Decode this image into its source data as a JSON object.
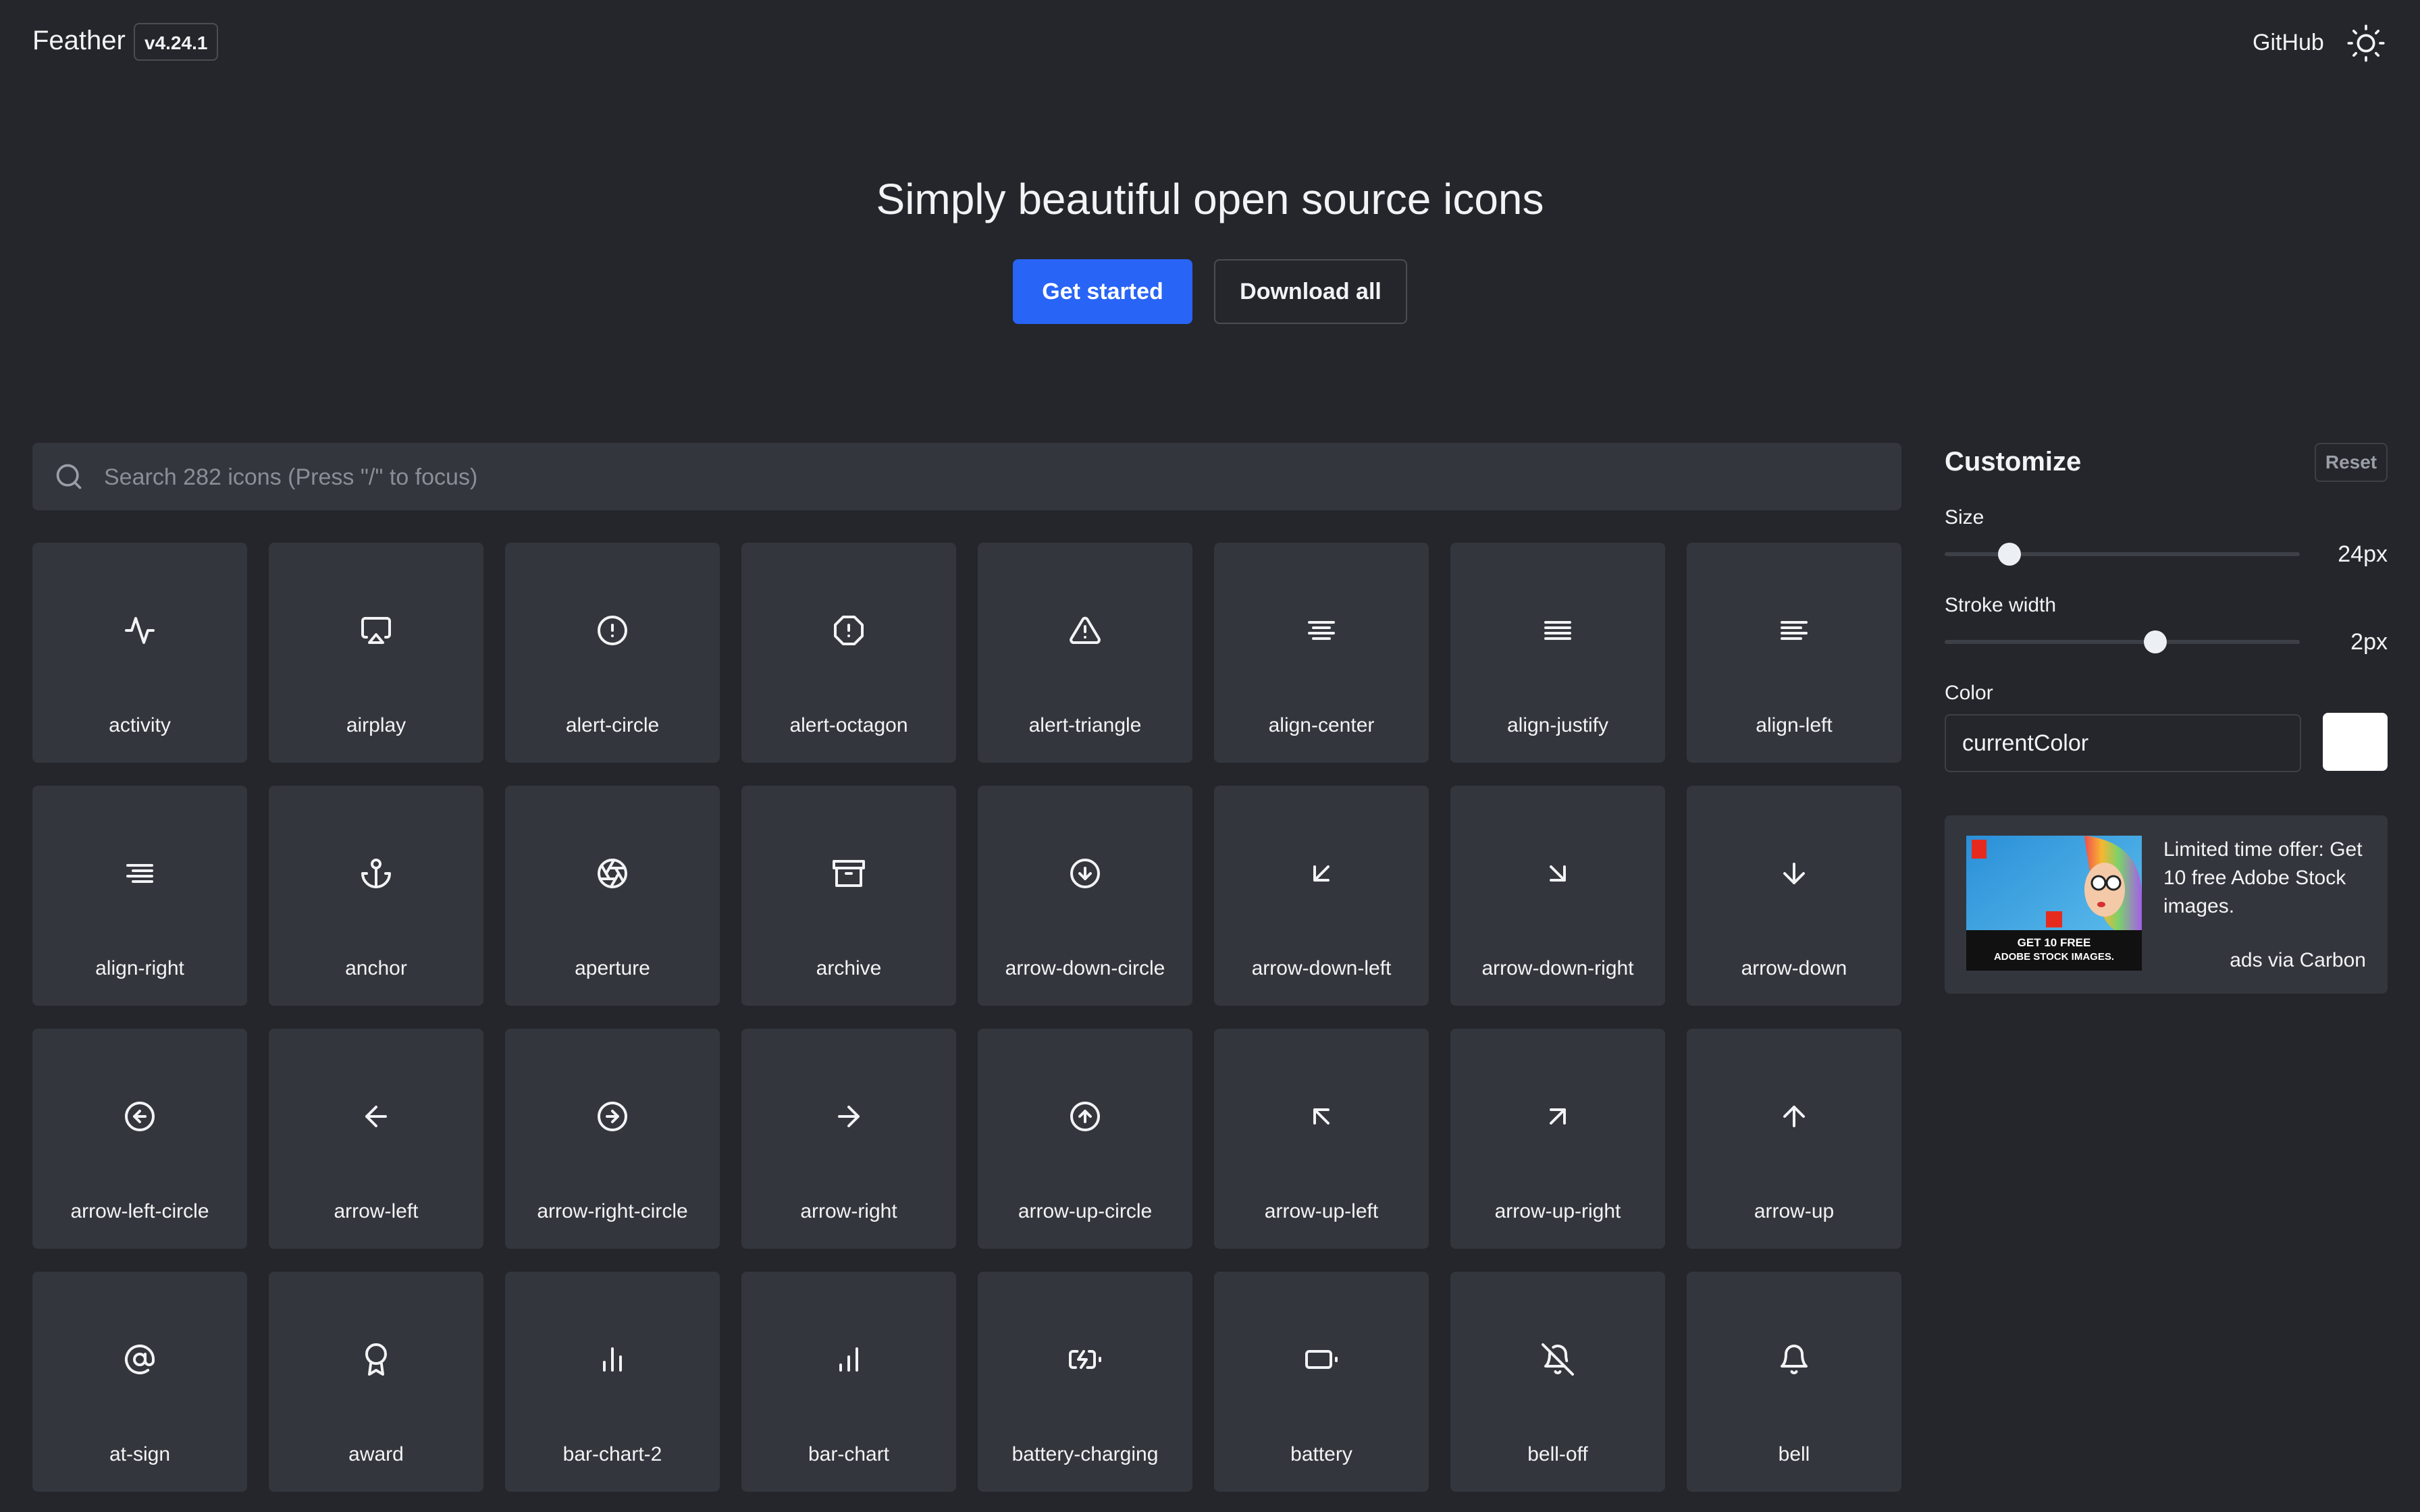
{
  "header": {
    "logo": "Feather",
    "version": "v4.24.1",
    "github_label": "GitHub",
    "theme_toggle_icon": "sun-icon"
  },
  "hero": {
    "title": "Simply beautiful open source icons",
    "primary_button": "Get started",
    "secondary_button": "Download all"
  },
  "search": {
    "placeholder": "Search 282 icons (Press \"/\" to focus)",
    "icon": "search-icon"
  },
  "icons": [
    {
      "label": "activity"
    },
    {
      "label": "airplay"
    },
    {
      "label": "alert-circle"
    },
    {
      "label": "alert-octagon"
    },
    {
      "label": "alert-triangle"
    },
    {
      "label": "align-center"
    },
    {
      "label": "align-justify"
    },
    {
      "label": "align-left"
    },
    {
      "label": "align-right"
    },
    {
      "label": "anchor"
    },
    {
      "label": "aperture"
    },
    {
      "label": "archive"
    },
    {
      "label": "arrow-down-circle"
    },
    {
      "label": "arrow-down-left"
    },
    {
      "label": "arrow-down-right"
    },
    {
      "label": "arrow-down"
    },
    {
      "label": "arrow-left-circle"
    },
    {
      "label": "arrow-left"
    },
    {
      "label": "arrow-right-circle"
    },
    {
      "label": "arrow-right"
    },
    {
      "label": "arrow-up-circle"
    },
    {
      "label": "arrow-up-left"
    },
    {
      "label": "arrow-up-right"
    },
    {
      "label": "arrow-up"
    },
    {
      "label": "at-sign"
    },
    {
      "label": "award"
    },
    {
      "label": "bar-chart-2"
    },
    {
      "label": "bar-chart"
    },
    {
      "label": "battery-charging"
    },
    {
      "label": "battery"
    },
    {
      "label": "bell-off"
    },
    {
      "label": "bell"
    }
  ],
  "customize": {
    "title": "Customize",
    "reset_label": "Reset",
    "size": {
      "label": "Size",
      "value": "24px",
      "fraction": 0.16
    },
    "stroke": {
      "label": "Stroke width",
      "value": "2px",
      "fraction": 0.6
    },
    "color": {
      "label": "Color",
      "value": "currentColor",
      "swatch": "#ffffff"
    }
  },
  "ad": {
    "text": "Limited time offer: Get 10 free Adobe Stock images.",
    "via": "ads via Carbon",
    "image_caption": "GET 10 FREE ADOBE STOCK IMAGES."
  },
  "colors": {
    "background": "#24262b",
    "surface": "#33363c",
    "accent": "#2864f6",
    "text": "#f2f3f5"
  }
}
